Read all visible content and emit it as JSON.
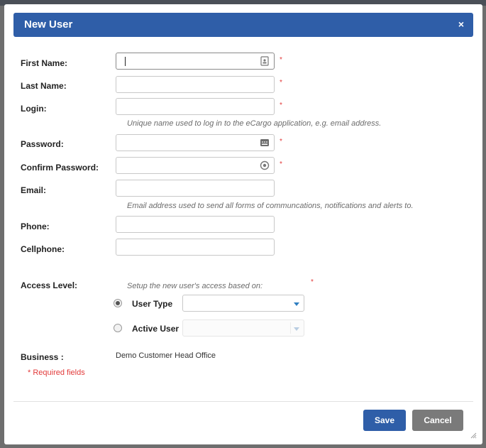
{
  "dialog": {
    "title": "New User",
    "close_glyph": "×"
  },
  "form": {
    "first_name": {
      "label": "First Name:",
      "value": "",
      "icon": "contact-card-icon",
      "required": "*"
    },
    "last_name": {
      "label": "Last Name:",
      "value": "",
      "required": "*"
    },
    "login": {
      "label": "Login:",
      "value": "",
      "required": "*",
      "hint": "Unique name used to log in to the eCargo application, e.g. email address."
    },
    "password": {
      "label": "Password:",
      "value": "",
      "icon": "password-generator-icon",
      "required": "*"
    },
    "confirm_password": {
      "label": "Confirm Password:",
      "value": "",
      "icon": "reveal-password-icon",
      "required": "*"
    },
    "email": {
      "label": "Email:",
      "value": "",
      "hint": "Email address used to send all forms of communcations, notifications and alerts to."
    },
    "phone": {
      "label": "Phone:",
      "value": ""
    },
    "cellphone": {
      "label": "Cellphone:",
      "value": ""
    }
  },
  "access": {
    "label": "Access Level:",
    "hint": "Setup the new user's access based on:",
    "required": "*",
    "options": [
      {
        "label": "User Type",
        "selected": true,
        "value": ""
      },
      {
        "label": "Active User",
        "selected": false,
        "value": "",
        "disabled": true
      }
    ]
  },
  "business": {
    "label": "Business :",
    "value": "Demo Customer Head Office"
  },
  "required_note": "* Required fields",
  "buttons": {
    "save": "Save",
    "cancel": "Cancel"
  },
  "colors": {
    "header": "#2f5ea8",
    "save_button": "#2f5ea8",
    "cancel_button": "#7a7a7a",
    "required": "#e23b3b"
  }
}
